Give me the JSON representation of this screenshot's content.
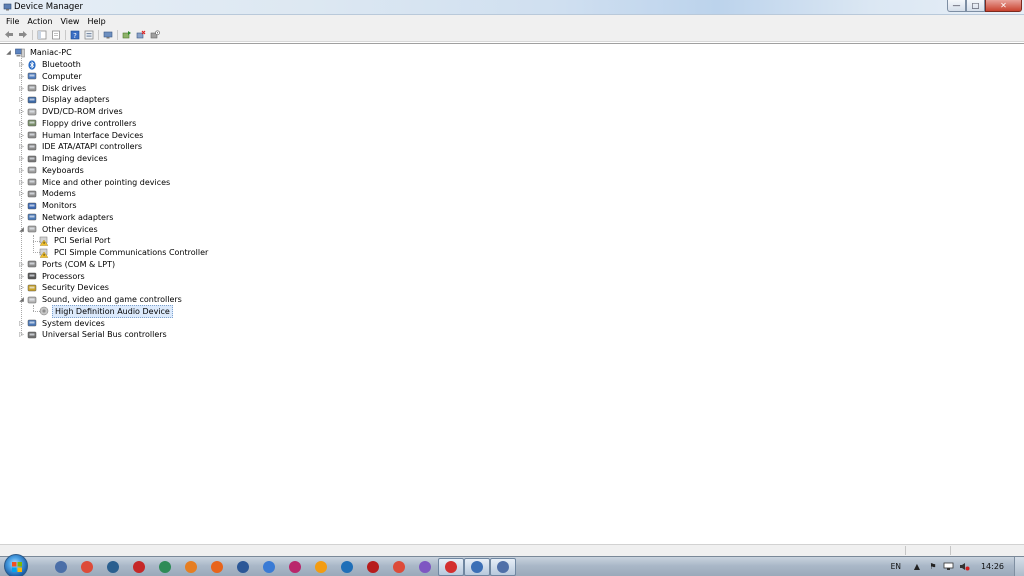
{
  "window": {
    "title": "Device Manager",
    "buttons": {
      "minimize": "—",
      "maximize": "□",
      "close": "✕"
    }
  },
  "menu": {
    "items": [
      "File",
      "Action",
      "View",
      "Help"
    ]
  },
  "toolbar": {
    "buttons": [
      "back-arrow-icon",
      "forward-arrow-icon",
      "show-hide-console-tree-icon",
      "properties-icon",
      "help-icon",
      "view-icon",
      "scan-hardware-icon",
      "update-driver-icon",
      "uninstall-icon",
      "disable-icon"
    ]
  },
  "tree": {
    "root": "Maniac-PC",
    "categories": [
      {
        "label": "Bluetooth",
        "icon": "bluetooth-icon"
      },
      {
        "label": "Computer",
        "icon": "computer-icon"
      },
      {
        "label": "Disk drives",
        "icon": "disk-drive-icon"
      },
      {
        "label": "Display adapters",
        "icon": "display-adapter-icon"
      },
      {
        "label": "DVD/CD-ROM drives",
        "icon": "dvd-drive-icon"
      },
      {
        "label": "Floppy drive controllers",
        "icon": "floppy-controller-icon"
      },
      {
        "label": "Human Interface Devices",
        "icon": "hid-icon"
      },
      {
        "label": "IDE ATA/ATAPI controllers",
        "icon": "ide-controller-icon"
      },
      {
        "label": "Imaging devices",
        "icon": "imaging-icon"
      },
      {
        "label": "Keyboards",
        "icon": "keyboard-icon"
      },
      {
        "label": "Mice and other pointing devices",
        "icon": "mouse-icon"
      },
      {
        "label": "Modems",
        "icon": "modem-icon"
      },
      {
        "label": "Monitors",
        "icon": "monitor-icon"
      },
      {
        "label": "Network adapters",
        "icon": "network-adapter-icon"
      },
      {
        "label": "Other devices",
        "icon": "other-devices-icon",
        "expanded": true,
        "children": [
          {
            "label": "PCI Serial Port",
            "icon": "unknown-device-warning-icon"
          },
          {
            "label": "PCI Simple Communications Controller",
            "icon": "unknown-device-warning-icon"
          }
        ]
      },
      {
        "label": "Ports (COM & LPT)",
        "icon": "port-icon"
      },
      {
        "label": "Processors",
        "icon": "processor-icon"
      },
      {
        "label": "Security Devices",
        "icon": "security-device-icon"
      },
      {
        "label": "Sound, video and game controllers",
        "icon": "sound-icon",
        "expanded": true,
        "children": [
          {
            "label": "High Definition Audio Device",
            "icon": "audio-device-icon",
            "selected": true
          }
        ]
      },
      {
        "label": "System devices",
        "icon": "system-device-icon"
      },
      {
        "label": "Universal Serial Bus controllers",
        "icon": "usb-icon"
      }
    ]
  },
  "taskbar": {
    "apps": [
      "explorer-icon",
      "chrome-icon",
      "steam-icon",
      "opera-icon",
      "utorrent-icon",
      "blender-icon",
      "firefox-icon",
      "ccleaner-icon",
      "thunder-icon",
      "fs-icon",
      "vlc-icon",
      "edge-icon",
      "ccleaner-red-icon",
      "chrome-icon",
      "winrar-icon",
      "red-app-icon",
      "device-manager-icon",
      "devmgmt-icon"
    ],
    "tray": {
      "language": "EN",
      "time": "14:26"
    }
  },
  "colors": {
    "accent": "#3399ff",
    "selection_bg": "#dceafc",
    "warning": "#f2c12e"
  }
}
